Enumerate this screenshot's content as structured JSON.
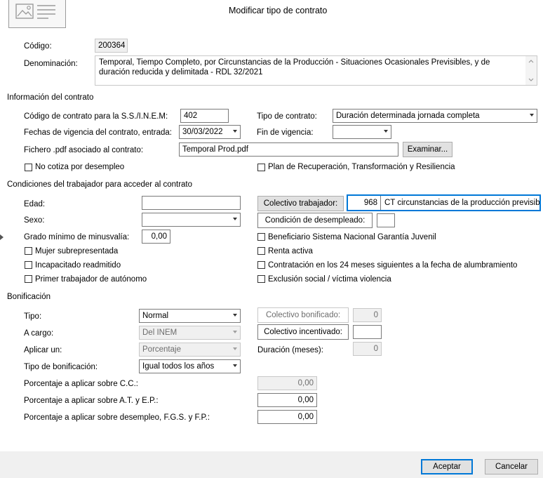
{
  "window": {
    "title": "Modificar tipo de contrato"
  },
  "header": {
    "codigo_label": "Código:",
    "codigo_value": "200364",
    "denominacion_label": "Denominación:",
    "denominacion_value": "Temporal, Tiempo Completo, por Circunstancias de la Producción - Situaciones Ocasionales Previsibles, y de duración reducida y delimitada - RDL 32/2021"
  },
  "info": {
    "section_title": "Información del contrato",
    "codigo_sepe_label": "Código de contrato para la S.S./I.N.E.M:",
    "codigo_sepe_value": "402",
    "tipo_label": "Tipo de contrato:",
    "tipo_value": "Duración determinada jornada completa",
    "fechas_label": "Fechas de vigencia del contrato, entrada:",
    "fecha_entrada": "30/03/2022",
    "fin_label": "Fin de vigencia:",
    "fin_value": "",
    "pdf_label": "Fichero .pdf asociado al contrato:",
    "pdf_value": "Temporal Prod.pdf",
    "examinar_button": "Examinar...",
    "no_cotiza_label": "No cotiza por desempleo",
    "plan_label": "Plan de Recuperación, Transformación y Resiliencia"
  },
  "conditions": {
    "section_title": "Condiciones del trabajador para acceder al contrato",
    "edad_label": "Edad:",
    "edad_value": "",
    "sexo_label": "Sexo:",
    "sexo_value": "",
    "grado_label": "Grado mínimo de minusvalía:",
    "grado_value": "0,00",
    "colectivo_button": "Colectivo trabajador:",
    "colectivo_code": "968",
    "colectivo_desc": "CT circunstancias de la producción previsib",
    "condicion_button": "Condición de desempleado:",
    "condicion_value": "",
    "mujer_label": "Mujer subrepresentada",
    "incapacitado_label": "Incapacitado readmitido",
    "autonomo_label": "Primer trabajador de autónomo",
    "beneficiario_label": "Beneficiario Sistema Nacional Garantía Juvenil",
    "renta_label": "Renta activa",
    "contratacion_label": "Contratación en los 24 meses siguientes a la fecha de alumbramiento",
    "exclusion_label": "Exclusión social  / víctima violencia"
  },
  "bonificacion": {
    "section_title": "Bonificación",
    "tipo_label": "Tipo:",
    "tipo_value": "Normal",
    "cargo_label": "A cargo:",
    "cargo_value": "Del INEM",
    "aplicar_label": "Aplicar un:",
    "aplicar_value": "Porcentaje",
    "tipo_bon_label": "Tipo de bonificación:",
    "tipo_bon_value": "Igual todos los años",
    "colectivo_bonificado_button": "Colectivo bonificado:",
    "colectivo_bonificado_value": "0",
    "colectivo_incentivado_button": "Colectivo incentivado:",
    "colectivo_incentivado_value": "",
    "duracion_label": "Duración (meses):",
    "duracion_value": "0",
    "pct_cc_label": "Porcentaje a aplicar sobre C.C.:",
    "pct_cc_value": "0,00",
    "pct_at_label": "Porcentaje a aplicar sobre A.T. y E.P.:",
    "pct_at_value": "0,00",
    "pct_desempleo_label": "Porcentaje a aplicar sobre desempleo, F.G.S. y F.P.:",
    "pct_desempleo_value": "0,00"
  },
  "footer": {
    "accept_button": "Aceptar",
    "cancel_button": "Cancelar"
  },
  "colors": {
    "focus_border": "#0078d7",
    "footer_bg": "#f0f0f0",
    "button_bg": "#e1e1e1"
  }
}
